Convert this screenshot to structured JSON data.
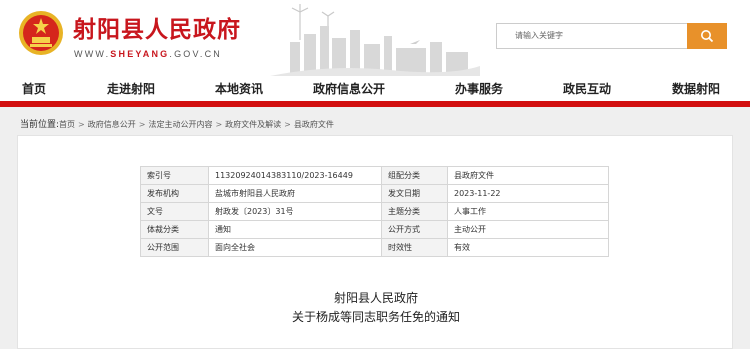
{
  "header": {
    "site_title": "射阳县人民政府",
    "site_url": "WWW.SHEYANG.GOV.CN",
    "search_placeholder": "请输入关键字"
  },
  "nav": {
    "items": [
      "首页",
      "走进射阳",
      "本地资讯",
      "政府信息公开",
      "办事服务",
      "政民互动",
      "数据射阳"
    ]
  },
  "breadcrumb": {
    "lead": "当前位置:",
    "items": [
      "首页",
      "政府信息公开",
      "法定主动公开内容",
      "政府文件及解读",
      "县政府文件"
    ]
  },
  "meta_table": {
    "rows": [
      [
        "索引号",
        "11320924014383110/2023-16449",
        "组配分类",
        "县政府文件"
      ],
      [
        "发布机构",
        "盐城市射阳县人民政府",
        "发文日期",
        "2023-11-22"
      ],
      [
        "文号",
        "射政发〔2023〕31号",
        "主题分类",
        "人事工作"
      ],
      [
        "体裁分类",
        "通知",
        "公开方式",
        "主动公开"
      ],
      [
        "公开范围",
        "面向全社会",
        "时效性",
        "有效"
      ]
    ]
  },
  "document": {
    "title_line1": "射阳县人民政府",
    "title_line2": "关于杨成等同志职务任免的通知"
  },
  "colors": {
    "brand_red": "#c8161d",
    "nav_bar": "#d20f0f",
    "search_button": "#e8912a"
  }
}
